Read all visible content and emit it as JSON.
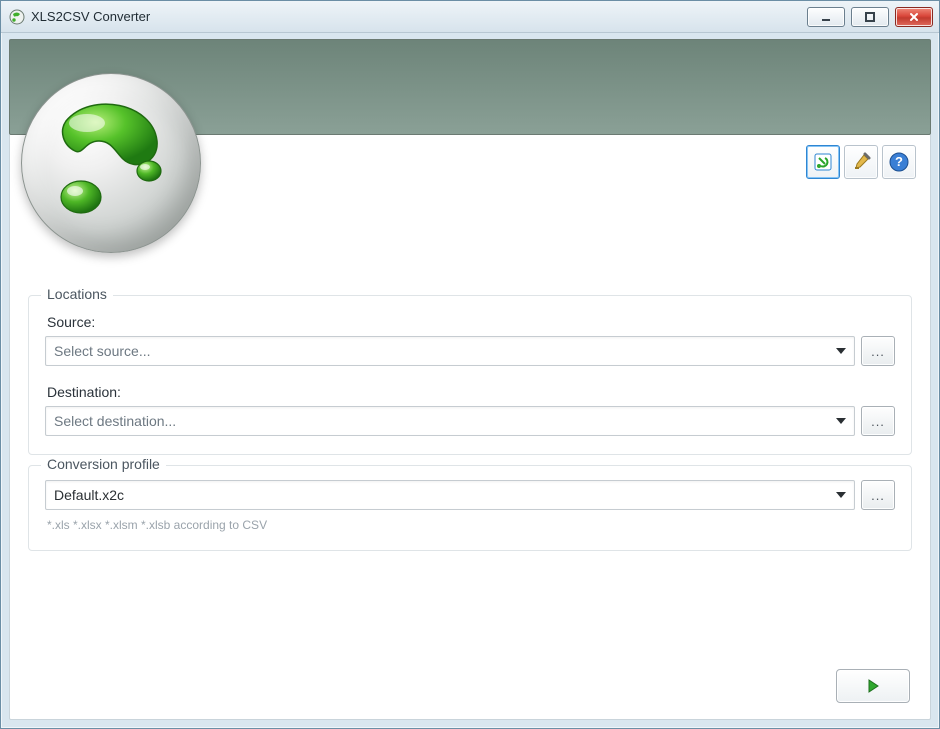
{
  "window": {
    "title": "XLS2CSV Converter"
  },
  "toolbar": {
    "convert_settings_tooltip": "Conversion settings",
    "options_tooltip": "Options",
    "help_tooltip": "Help"
  },
  "locations": {
    "legend": "Locations",
    "source_label": "Source:",
    "source_placeholder": "Select source...",
    "destination_label": "Destination:",
    "destination_placeholder": "Select destination...",
    "browse_label": "..."
  },
  "profile": {
    "legend": "Conversion profile",
    "value": "Default.x2c",
    "hint": "*.xls *.xlsx *.xlsm *.xlsb according to CSV",
    "browse_label": "..."
  },
  "footer": {
    "run_tooltip": "Start conversion"
  }
}
